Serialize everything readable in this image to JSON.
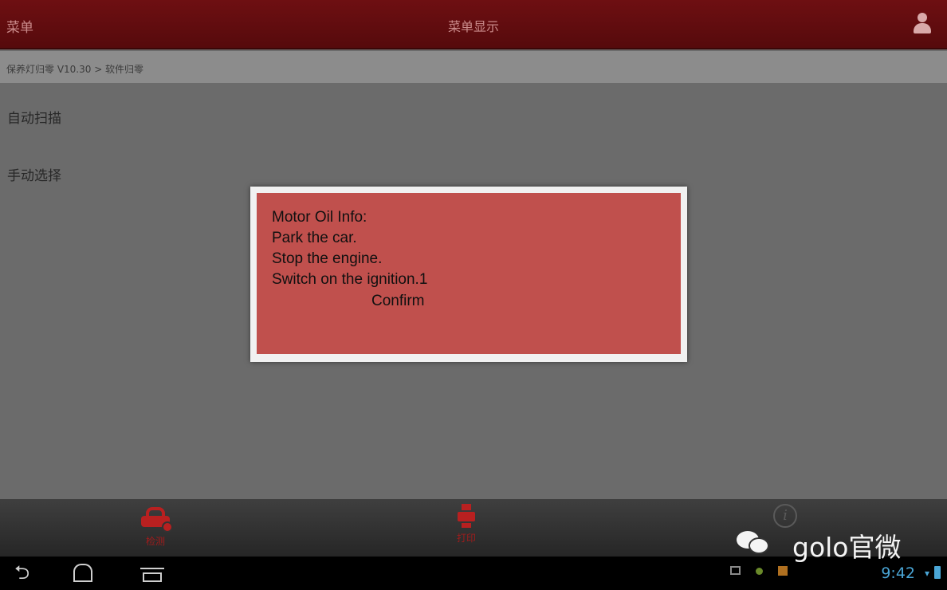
{
  "titlebar": {
    "menu_label": "菜单",
    "title": "菜单显示"
  },
  "breadcrumb": "保养灯归零 V10.30 > 软件归零",
  "menu": {
    "items": [
      "自动扫描",
      "手动选择"
    ]
  },
  "dialog": {
    "lines": [
      "Motor Oil Info:",
      "Park the car.",
      "Stop the engine.",
      "Switch on the ignition.1"
    ],
    "confirm_label": "Confirm"
  },
  "bottombar": {
    "items": [
      {
        "label": "检测",
        "icon": "car-check-icon"
      },
      {
        "label": "打印",
        "icon": "printer-icon"
      },
      {
        "label": "",
        "icon": "info-icon"
      }
    ]
  },
  "status": {
    "time": "9:42"
  },
  "watermark": {
    "text": "golo官微"
  },
  "colors": {
    "titlebar": "#6e0f12",
    "dialog": "#c0504d",
    "accent_red": "#b82020",
    "status_blue": "#4aa6d6"
  }
}
